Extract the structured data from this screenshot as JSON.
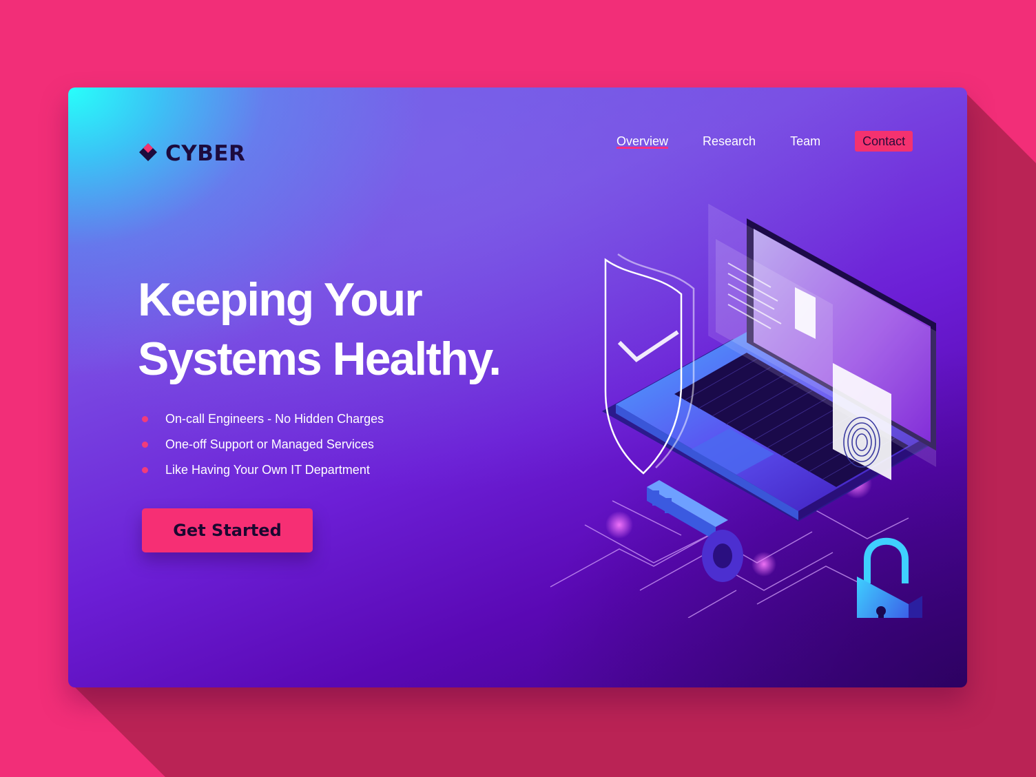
{
  "colors": {
    "background": "#f22e78",
    "accent": "#f4326f",
    "card_gradient_start": "#28fffa",
    "card_gradient_end": "#3f0283",
    "text_dark": "#1d0b3d"
  },
  "logo": {
    "icon": "diamond-logo-icon",
    "text": "CYBER"
  },
  "nav": {
    "items": [
      {
        "label": "Overview",
        "active": true
      },
      {
        "label": "Research",
        "active": false
      },
      {
        "label": "Team",
        "active": false
      },
      {
        "label": "Contact",
        "active": false
      }
    ]
  },
  "hero": {
    "title_line1": "Keeping Your",
    "title_line2": "Systems Healthy.",
    "bullets": [
      "On-call Engineers - No Hidden Charges",
      "One-off Support or Managed Services",
      "Like Having Your Own IT Department"
    ],
    "cta_label": "Get Started"
  },
  "illustration": {
    "icons": [
      "laptop-icon",
      "shield-check-icon",
      "fingerprint-icon",
      "key-icon",
      "padlock-icon"
    ]
  }
}
